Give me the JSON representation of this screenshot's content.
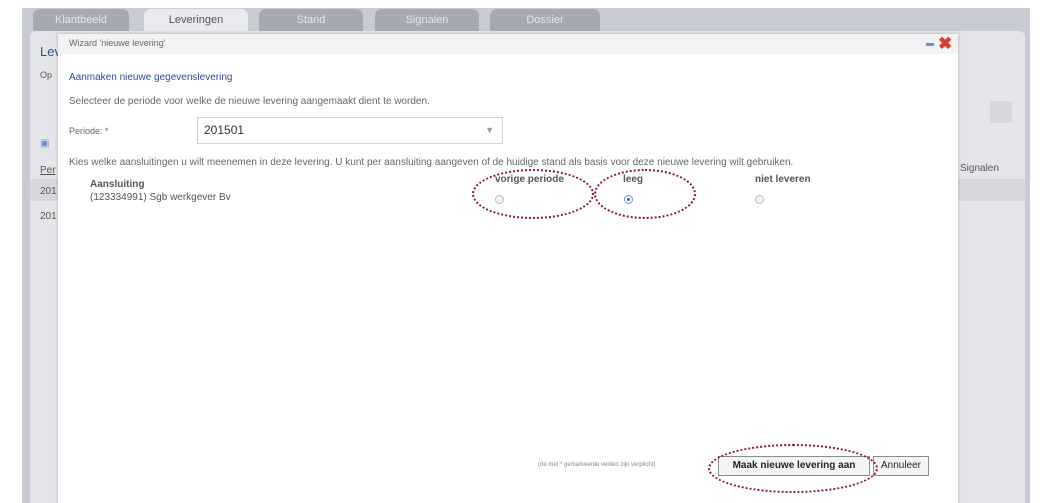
{
  "tabs": [
    "Klantbeeld",
    "Leveringen",
    "Stand",
    "Signalen",
    "Dossier"
  ],
  "background": {
    "page_title_fragment": "Lev",
    "subtitle_fragment": "Op",
    "column_fragment": "Per",
    "row_fragments": [
      "201",
      "201"
    ],
    "signalen_header": "Signalen"
  },
  "modal": {
    "title": "Wizard 'nieuwe levering'",
    "heading": "Aanmaken nieuwe gegevenslevering",
    "instruction_period": "Selecteer de periode voor welke de nieuwe levering aangemaakt dient te worden.",
    "periode_label": "Periode: *",
    "periode_value": "201501",
    "instruction_connections": "Kies welke aansluitingen u wilt meenemen in deze levering. U kunt per aansluiting aangeven of de huidige stand als basis voor deze nieuwe levering wilt gebruiken.",
    "columns": {
      "aansluiting": "Aansluiting",
      "vorige": "vorige periode",
      "leeg": "leeg",
      "niet": "niet leveren"
    },
    "rows": [
      {
        "name": "(123334991) Sgb werkgever Bv",
        "selected": "leeg"
      }
    ],
    "footnote": "(de met * gemarkeerde velden zijn verplicht)",
    "buttons": {
      "create": "Maak nieuwe levering aan",
      "cancel": "Annuleer"
    }
  }
}
